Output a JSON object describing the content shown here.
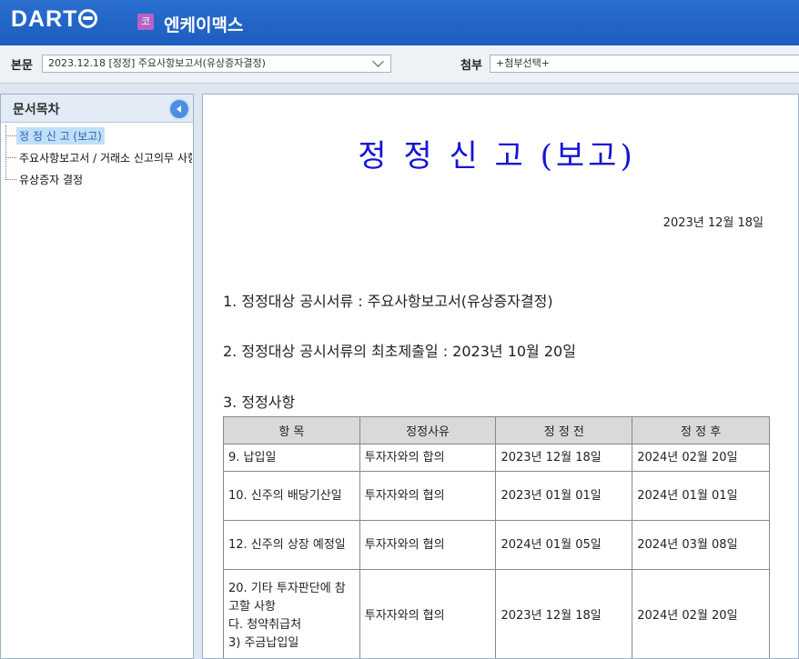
{
  "header": {
    "logo": "DART",
    "company_badge": "코",
    "company_name": "엔케이맥스"
  },
  "toolbar": {
    "body_label": "본문",
    "body_select": "2023.12.18 [정정] 주요사항보고서(유상증자결정)",
    "attach_label": "첨부",
    "attach_select": "+첨부선택+"
  },
  "toc": {
    "title": "문서목차",
    "items": [
      {
        "label": "정 정 신 고 (보고)"
      },
      {
        "label": "주요사항보고서 / 거래소 신고의무 사항"
      },
      {
        "label": "유상증자 결정"
      }
    ]
  },
  "document": {
    "title": "정 정 신 고 (보고)",
    "date": "2023년 12월 18일",
    "item1": "1. 정정대상 공시서류 : 주요사항보고서(유상증자결정)",
    "item2": "2. 정정대상 공시서류의 최초제출일 : 2023년 10월 20일",
    "item3": "3. 정정사항",
    "table": {
      "headers": [
        "항 목",
        "정정사유",
        "정 정 전",
        "정 정 후"
      ],
      "rows": [
        {
          "item": "9. 납입일",
          "reason": "투자자와의 합의",
          "before": "2023년 12월 18일",
          "after": "2024년 02월 20일"
        },
        {
          "item": "10. 신주의 배당기산일",
          "reason": "투자자와의 협의",
          "before": "2023년 01월 01일",
          "after": "2024년 01월 01일"
        },
        {
          "item": "12. 신주의 상장 예정일",
          "reason": "투자자와의 협의",
          "before": "2024년 01월 05일",
          "after": "2024년 03월 08일"
        },
        {
          "item": "20. 기타 투자판단에 참고할 사항\n다. 청약취급처\n3) 주금납입일",
          "reason": "투자자와의 협의",
          "before": "2023년 12월 18일",
          "after": "2024년 02월 20일"
        }
      ]
    }
  }
}
